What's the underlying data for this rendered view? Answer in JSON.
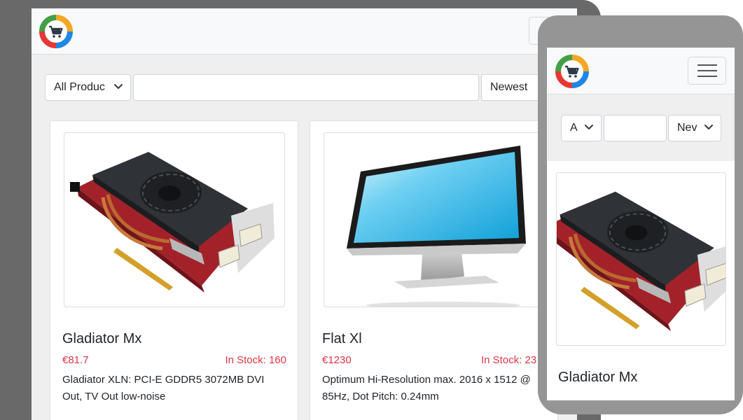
{
  "brand": {
    "logo_icon": "shopping-cart-ring-logo",
    "ring_colors": [
      "#f5a623",
      "#e53935",
      "#43a047",
      "#1e88e5"
    ]
  },
  "navbar": {
    "menu_icon": "hamburger-menu-icon"
  },
  "filters": {
    "category_value": "All Produc",
    "search_value": "",
    "sort_value": "Newest"
  },
  "products": [
    {
      "name": "Gladiator Mx",
      "price": "€81.7",
      "stock": "In Stock: 160",
      "description": "Gladiator XLN: PCI-E GDDR5 3072MB DVI Out, TV Out low-noise",
      "image_icon": "graphics-card-image"
    },
    {
      "name": "Flat Xl",
      "price": "€1230",
      "stock": "In Stock: 23",
      "description_line1": "Optimum Hi-Resolution max. 2016 x 1512 @",
      "description_line2": "85Hz, Dot Pitch: 0.24mm",
      "image_icon": "monitor-image"
    }
  ],
  "mobile": {
    "category_value": "A",
    "sort_value": "Nev",
    "product_name": "Gladiator Mx"
  },
  "colors": {
    "price_red": "#dc3545",
    "text": "#212529",
    "page_bg": "#efefef"
  }
}
